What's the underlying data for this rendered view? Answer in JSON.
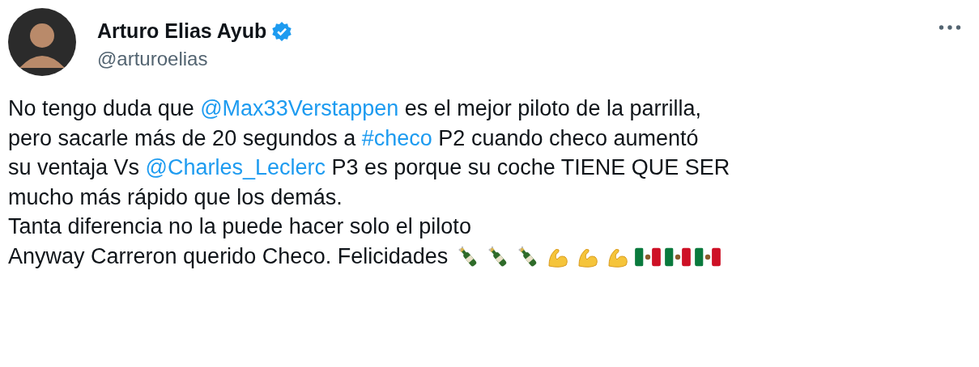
{
  "author": {
    "name": "Arturo Elias Ayub",
    "handle": "@arturoelias",
    "verified": true
  },
  "body": [
    [
      {
        "kind": "text",
        "text": "No tengo duda que "
      },
      {
        "kind": "mention",
        "text": "@Max33Verstappen"
      },
      {
        "kind": "text",
        "text": " es el mejor piloto de la parrilla,"
      }
    ],
    [
      {
        "kind": "text",
        "text": "pero sacarle más de 20 segundos a "
      },
      {
        "kind": "hashtag",
        "text": "#checo"
      },
      {
        "kind": "text",
        "text": " P2 cuando checo aumentó"
      }
    ],
    [
      {
        "kind": "text",
        "text": "su ventaja Vs "
      },
      {
        "kind": "mention",
        "text": "@Charles_Leclerc"
      },
      {
        "kind": "text",
        "text": " P3 es porque su coche TIENE QUE SER"
      }
    ],
    [
      {
        "kind": "text",
        "text": "mucho más rápido que los demás."
      }
    ],
    [
      {
        "kind": "text",
        "text": "Tanta diferencia no la puede hacer solo el piloto"
      }
    ],
    [
      {
        "kind": "text",
        "text": "Anyway Carreron querido Checo.  Felicidades "
      }
    ]
  ]
}
